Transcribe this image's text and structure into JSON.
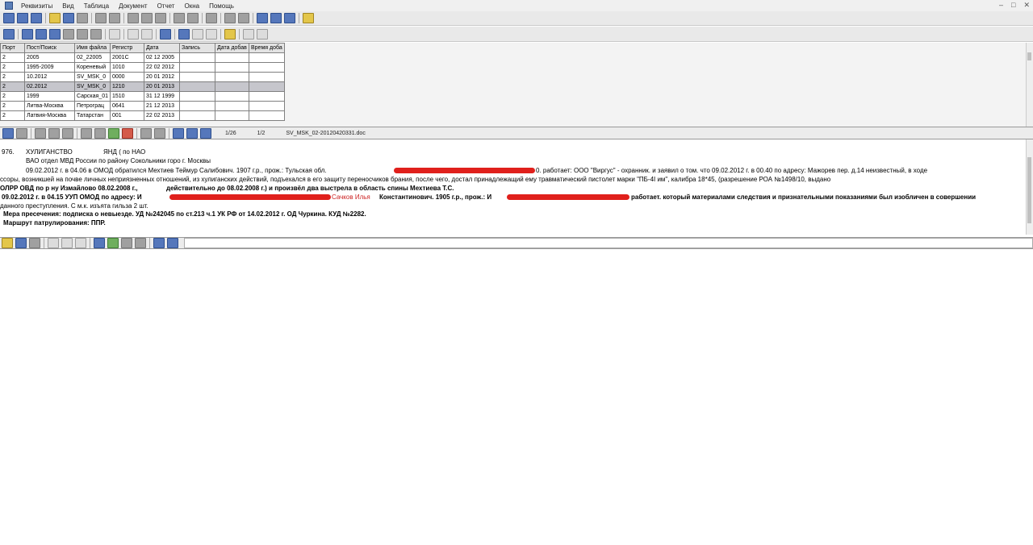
{
  "menu": {
    "items": [
      "Реквизиты",
      "Вид",
      "Таблица",
      "Документ",
      "Отчет",
      "Окна",
      "Помощь"
    ],
    "window_controls": [
      "–",
      "□",
      "✕"
    ]
  },
  "grid": {
    "columns": [
      "Порт",
      "Пост/Поиск",
      "Имя файла",
      "Регистр",
      "Дата",
      "Запись",
      "Дата добав",
      "Время доба"
    ],
    "rows": [
      [
        "2",
        "2005",
        "02_22005",
        "2001С",
        "02 12 2005",
        "",
        "",
        ""
      ],
      [
        "2",
        "1995-2009",
        "Кореневый",
        "1010",
        "22 02 2012",
        "",
        "",
        ""
      ],
      [
        "2",
        "10.2012",
        "SV_MSK_0",
        "0000",
        "20 01 2012",
        "",
        "",
        ""
      ],
      [
        "2",
        "02.2012",
        "SV_MSK_0",
        "1210",
        "20 01 2013",
        "",
        "",
        ""
      ],
      [
        "2",
        "1999",
        "Сарская_01",
        "1510",
        "31 12 1999",
        "",
        "",
        ""
      ],
      [
        "2",
        "Литва-Москва",
        "Петрограц",
        "0641",
        "21 12 2013",
        "",
        "",
        ""
      ],
      [
        "2",
        "Латвия-Москва",
        "Татарстан",
        "001",
        "22 02 2013",
        "",
        "",
        ""
      ]
    ]
  },
  "doc_toolbar": {
    "page_counter": "1/26",
    "part_counter": "1/2",
    "filename": "SV_MSK_02-20120420331.doc"
  },
  "document": {
    "code": "976.",
    "category": "ХУЛИГАНСТВО",
    "region": "ЯНД ( по НАО",
    "department": "ВАО отдел МВД России по району Сокольники горо г. Москвы",
    "line1": "09.02.2012 г. в 04.06 в ОМОД обратился Мехтиев Теймур Салибович. 1907 г.р., прож.: Тульская обл.",
    "line1_tail": "0. работает: ООО \"Виргус\" - охранник. и заявил о том. что 09.02.2012 г. в 00.40 по адресу: Мажорев пер. д.14 неизвестный, в ходе",
    "line2": "ссоры, возникшей на почве личных неприязненных отношений, из хулиганских действий, подъехался в его защиту переносчиков брания, после чего, достал принадлежащий ему травматический пистолет марки \"ПБ-4I им\", калибра 18*45, (разрешение РОА №1498/10, выдано",
    "line3_a": "ОЛРР ОВД по р ну Измайлово 08.02.2008 г.,",
    "line3_b": "действительно до 08.02.2008 г.) и произвёл два выстрела в область спины Мехтиева Т.С.",
    "line4_a": "09.02.2012 г. в 04.15 УУП ОМОД по адресу: И",
    "line4_name": "Сачков Илья",
    "line4_b": "Константинович. 1905 г.р., прож.: И",
    "line4_tail": "работает. который материалами следствия и признательными показаниями был изобличен в совершении",
    "line5": "данного преступления. С м.к. изъята гильза 2 шт.",
    "line6": "Мера пресечения: подписка о невыезде. УД №242045 по ст.213 ч.1 УК РФ от 14.02.2012 г. ОД Чуркина. КУД    №2282.",
    "line7": "Маршрут патрулирования: ППР."
  }
}
